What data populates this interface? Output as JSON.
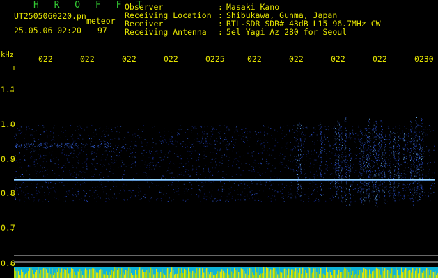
{
  "header": {
    "brand": "H R O F F T",
    "file_name": "UT2505060220.pn",
    "detection_type": "meteor",
    "date_time": "25.05.06 02:20",
    "count": "97"
  },
  "info": [
    {
      "label": "Observer",
      "value": "Masaki Kano"
    },
    {
      "label": "Receiving Location",
      "value": "Shibukawa, Gunma, Japan"
    },
    {
      "label": "Receiver",
      "value": "RTL-SDR SDR# 43dB L15 96.7MHz CW"
    },
    {
      "label": "Receiving Antenna",
      "value": "5el Yagi Az 280 for Seoul"
    }
  ],
  "colon": ":",
  "axis": {
    "unit": "kHz",
    "time_ticks": [
      "022",
      "022",
      "022",
      "022",
      "0225",
      "022",
      "022",
      "022",
      "022",
      "0230"
    ],
    "freq_labels": [
      "1.1",
      "1.0",
      "0.9",
      "0.8",
      "0.7",
      "0.6"
    ]
  },
  "colors": {
    "text": "#e6e600",
    "brand": "#32c832",
    "background": "#000000",
    "signal_line": "#8fd2ff",
    "noise": "#1f3fbf"
  }
}
